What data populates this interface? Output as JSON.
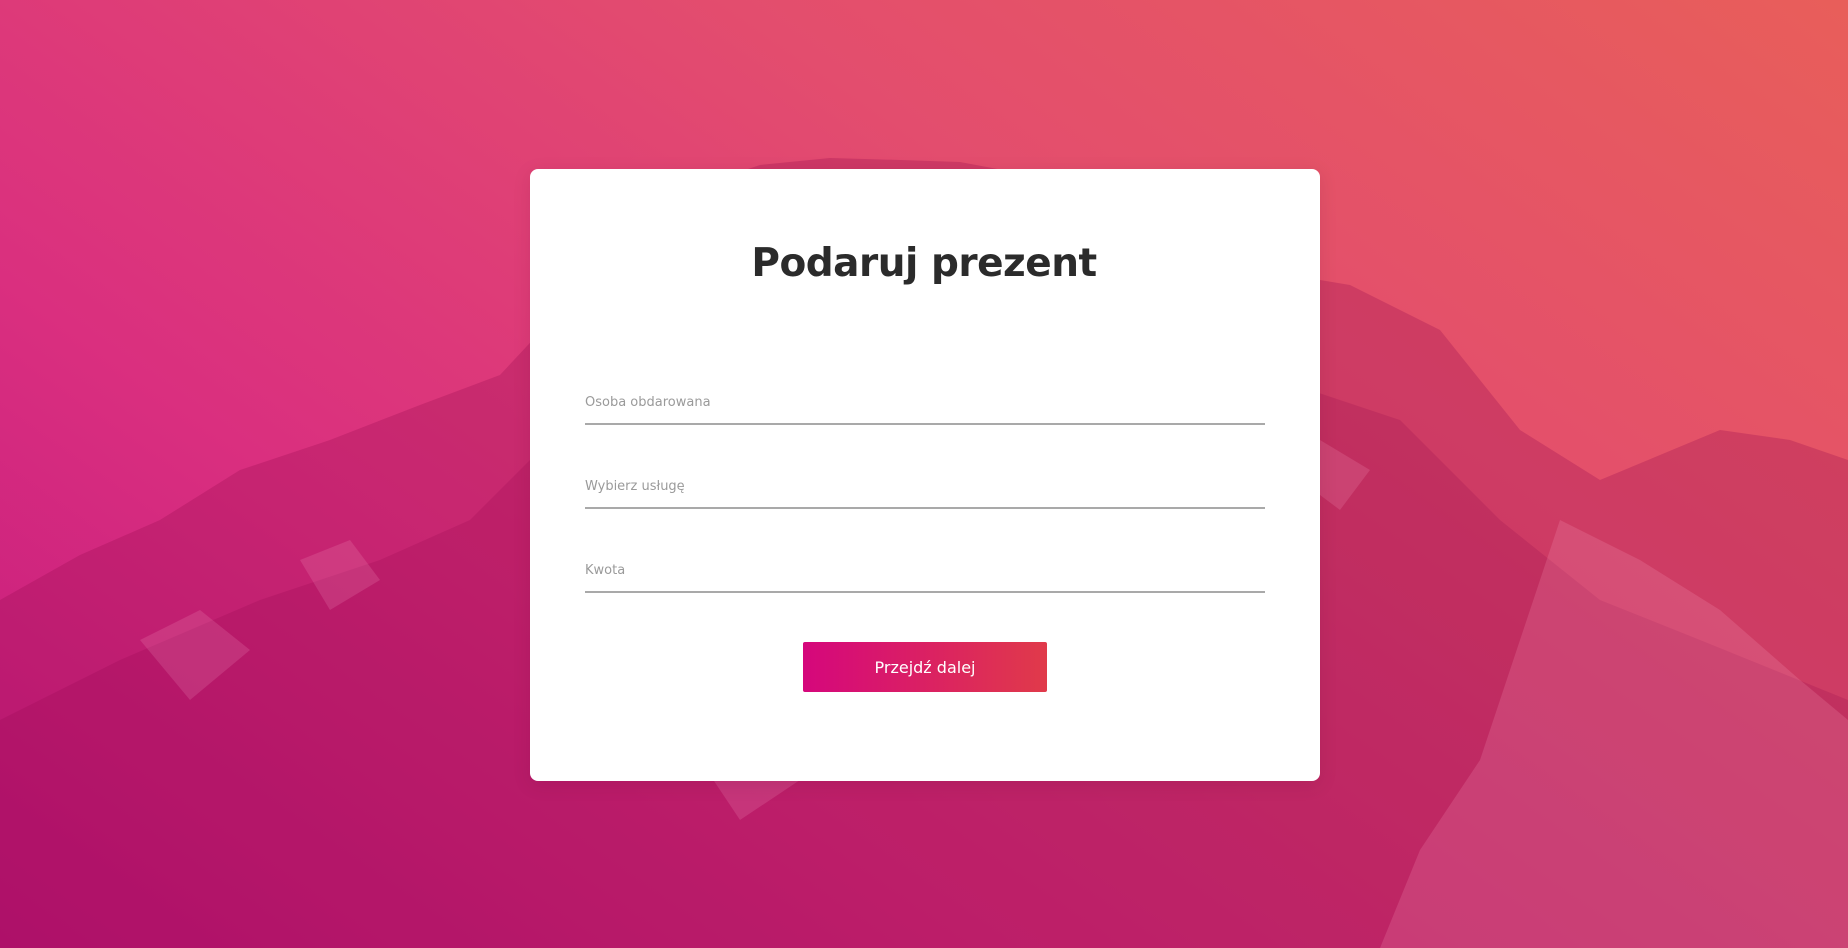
{
  "page": {
    "title": "Podaruj prezent"
  },
  "form": {
    "fields": [
      {
        "placeholder": "Osoba obdarowana",
        "value": ""
      },
      {
        "placeholder": "Wybierz usługę",
        "value": ""
      },
      {
        "placeholder": "Kwota",
        "value": ""
      }
    ],
    "submit_label": "Przejdź dalej"
  },
  "colors": {
    "background_gradient": [
      "#c2187e",
      "#da2f7f",
      "#e34d6e",
      "#e85e5a"
    ],
    "button_gradient": [
      "#d5077c",
      "#e03a4a"
    ],
    "title_text": "#2b2b2b",
    "field_underline": "#a9a9a9"
  }
}
